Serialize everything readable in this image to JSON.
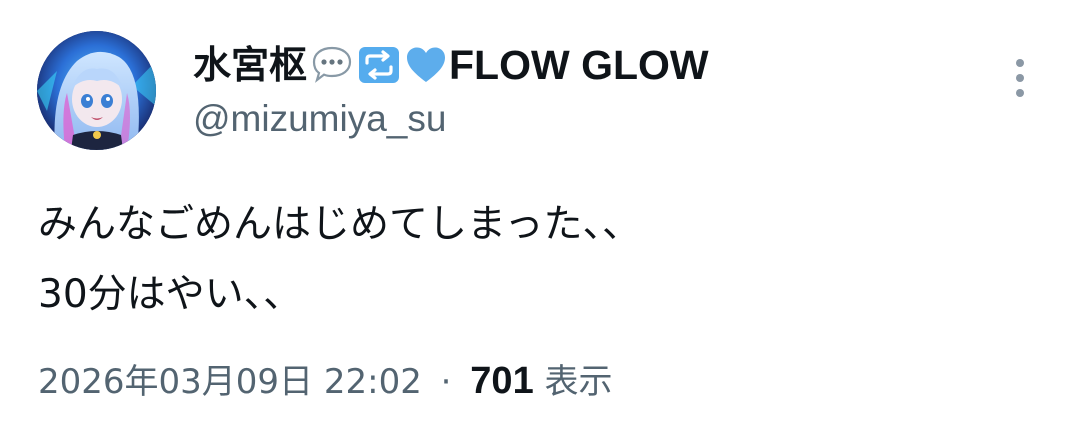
{
  "author": {
    "display_name": "水宮枢",
    "name_emojis": [
      "speech-bubble-emoji",
      "repeat-arrows-emoji",
      "blue-heart-emoji"
    ],
    "brand_text": "FLOW GLOW",
    "handle": "@mizumiya_su",
    "avatar": "anime-girl-avatar"
  },
  "tweet": {
    "lines": [
      "みんなごめんはじめてしまった、、",
      "30分はやい、、"
    ]
  },
  "meta": {
    "timestamp": "2026年03月09日 22:02",
    "separator": "·",
    "view_count": "701",
    "view_label": "表示"
  },
  "icons": {
    "more": "more-vertical-icon"
  },
  "colors": {
    "text_primary": "#0f1419",
    "text_secondary": "#536471",
    "emoji_blue": "#55acee",
    "heart_blue": "#5dadec"
  }
}
